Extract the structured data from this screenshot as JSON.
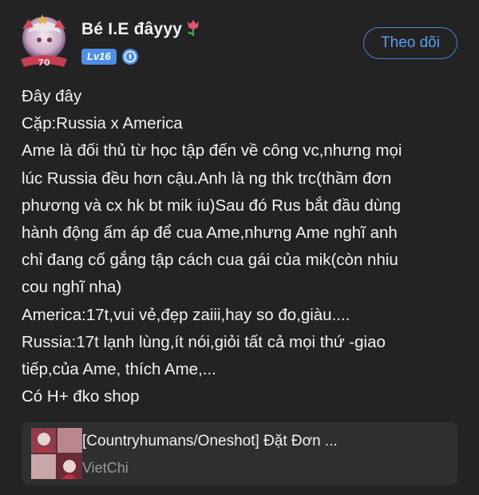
{
  "user": {
    "name": "Bé I.E đâyyy",
    "level": "Lv16",
    "avatar_badge": "70",
    "icons": [
      "tulip-icon",
      "verified-icon"
    ]
  },
  "follow_button": {
    "label": "Theo dõi"
  },
  "post": {
    "lines": [
      "Đây đây",
      "Cặp:Russia x America",
      "Ame là đối thủ từ học tập đến về công vc,nhưng mọi",
      "lúc Russia đều hơn cậu.Anh là ng thk trc(thầm đơn",
      "phương và cx hk bt mik iu)Sau đó Rus bắt đầu dùng",
      "hành động ấm áp để cua Ame,nhưng Ame nghĩ anh",
      "chỉ đang cố gắng tập cách cua gái của mik(còn nhiu",
      "cou nghĩ nha)",
      "America:17t,vui vẻ,đẹp zaiii,hay so đo,giàu....",
      "Russia:17t lạnh lùng,ít nói,giỏi tất cả mọi thứ -giao",
      "tiếp,của Ame, thích Ame,...",
      "Có H+ đko shop"
    ]
  },
  "linked_story": {
    "title": "[Countryhumans/Oneshot] Đặt Đơn ...",
    "author": "VietChi"
  },
  "colors": {
    "background": "#232323",
    "accent": "#4a86d6",
    "level_badge": "#4f8fe6",
    "card": "#2f2f2f",
    "muted_text": "#9a9a9a"
  }
}
